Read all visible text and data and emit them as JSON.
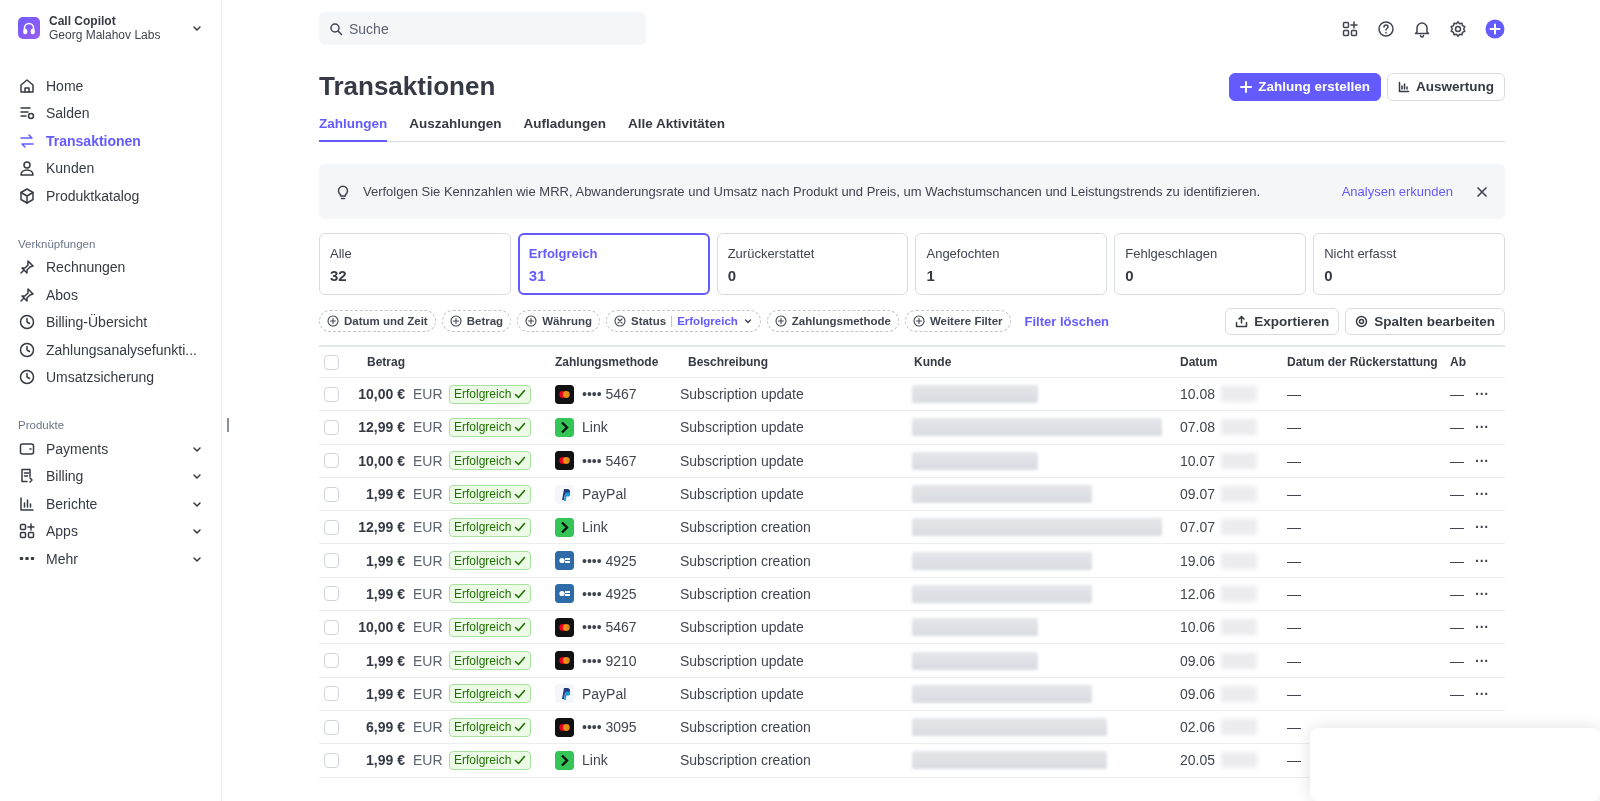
{
  "account": {
    "name": "Call Copilot",
    "org": "Georg Malahov Labs"
  },
  "sidebar": {
    "items": [
      {
        "label": "Home",
        "selected": false
      },
      {
        "label": "Salden",
        "selected": false
      },
      {
        "label": "Transaktionen",
        "selected": true
      },
      {
        "label": "Kunden",
        "selected": false
      },
      {
        "label": "Produktkatalog",
        "selected": false
      }
    ],
    "sections": [
      {
        "title": "Verknüpfungen",
        "items": [
          {
            "label": "Rechnungen"
          },
          {
            "label": "Abos"
          },
          {
            "label": "Billing-Übersicht"
          },
          {
            "label": "Zahlungsanalysefunkti..."
          },
          {
            "label": "Umsatzsicherung"
          }
        ]
      },
      {
        "title": "Produkte",
        "items": [
          {
            "label": "Payments",
            "expanded": false
          },
          {
            "label": "Billing",
            "expanded": false
          },
          {
            "label": "Berichte",
            "expanded": false
          },
          {
            "label": "Apps",
            "expanded": false
          },
          {
            "label": "Mehr",
            "expanded": false
          }
        ]
      }
    ]
  },
  "search": {
    "placeholder": "Suche"
  },
  "page_title": "Transaktionen",
  "actions": [
    {
      "label": "Zahlung erstellen",
      "kind": "primary"
    },
    {
      "label": "Auswertung",
      "kind": "secondary"
    }
  ],
  "tabs": [
    {
      "label": "Zahlungen",
      "selected": true
    },
    {
      "label": "Auszahlungen",
      "selected": false
    },
    {
      "label": "Aufladungen",
      "selected": false
    },
    {
      "label": "Alle Aktivitäten",
      "selected": false
    }
  ],
  "banner": {
    "text": "Verfolgen Sie Kennzahlen wie MRR, Abwanderungsrate und Umsatz nach Produkt und Preis, um Wachstumschancen und Leistungstrends zu identifizieren.",
    "link": "Analysen erkunden"
  },
  "status_cards": [
    {
      "label": "Alle",
      "count": "32",
      "selected": false
    },
    {
      "label": "Erfolgreich",
      "count": "31",
      "selected": true
    },
    {
      "label": "Zurückerstattet",
      "count": "0",
      "selected": false
    },
    {
      "label": "Angefochten",
      "count": "1",
      "selected": false
    },
    {
      "label": "Fehlgeschlagen",
      "count": "0",
      "selected": false
    },
    {
      "label": "Nicht erfasst",
      "count": "0",
      "selected": false
    }
  ],
  "filters": [
    {
      "kind": "add",
      "label": "Datum und Zeit"
    },
    {
      "kind": "add",
      "label": "Betrag"
    },
    {
      "kind": "add",
      "label": "Währung"
    },
    {
      "kind": "active",
      "label": "Status",
      "value": "Erfolgreich"
    },
    {
      "kind": "add",
      "label": "Zahlungsmethode"
    },
    {
      "kind": "add",
      "label": "Weitere Filter"
    }
  ],
  "clear_filters": "Filter löschen",
  "toolbar": [
    {
      "label": "Exportieren",
      "kind": "export"
    },
    {
      "label": "Spalten bearbeiten",
      "kind": "settings"
    }
  ],
  "table": {
    "select_all_checked": false,
    "columns": [
      "Betrag",
      "Zahlungsmethode",
      "Beschreibung",
      "Kunde",
      "Datum",
      "Datum der Rückerstattung",
      "Ab"
    ],
    "rows": [
      {
        "amount": "10,00 €",
        "currency": "EUR",
        "status": "Erfolgreich",
        "kind": "mastercard",
        "method": "•••• 5467",
        "description": "Subscription update",
        "date": "10.08",
        "refund": "—",
        "column_7": "—",
        "menu": "···",
        "checked": false
      },
      {
        "amount": "12,99 €",
        "currency": "EUR",
        "status": "Erfolgreich",
        "kind": "link",
        "method": "Link",
        "description": "Subscription update",
        "date": "07.08",
        "refund": "—",
        "column_7": "—",
        "menu": "···",
        "checked": false
      },
      {
        "amount": "10,00 €",
        "currency": "EUR",
        "status": "Erfolgreich",
        "kind": "mastercard",
        "method": "•••• 5467",
        "description": "Subscription update",
        "date": "10.07",
        "refund": "—",
        "column_7": "—",
        "menu": "···",
        "checked": false
      },
      {
        "amount": "1,99 €",
        "currency": "EUR",
        "status": "Erfolgreich",
        "kind": "paypal",
        "method": "PayPal",
        "description": "Subscription update",
        "date": "09.07",
        "refund": "—",
        "column_7": "—",
        "menu": "···",
        "checked": false
      },
      {
        "amount": "12,99 €",
        "currency": "EUR",
        "status": "Erfolgreich",
        "kind": "link",
        "method": "Link",
        "description": "Subscription creation",
        "date": "07.07",
        "refund": "—",
        "column_7": "—",
        "menu": "···",
        "checked": false
      },
      {
        "amount": "1,99 €",
        "currency": "EUR",
        "status": "Erfolgreich",
        "kind": "card",
        "method": "•••• 4925",
        "description": "Subscription creation",
        "date": "19.06",
        "refund": "—",
        "column_7": "—",
        "menu": "···",
        "checked": false
      },
      {
        "amount": "1,99 €",
        "currency": "EUR",
        "status": "Erfolgreich",
        "kind": "card",
        "method": "•••• 4925",
        "description": "Subscription creation",
        "date": "12.06",
        "refund": "—",
        "column_7": "—",
        "menu": "···",
        "checked": false
      },
      {
        "amount": "10,00 €",
        "currency": "EUR",
        "status": "Erfolgreich",
        "kind": "mastercard",
        "method": "•••• 5467",
        "description": "Subscription update",
        "date": "10.06",
        "refund": "—",
        "column_7": "—",
        "menu": "···",
        "checked": false
      },
      {
        "amount": "1,99 €",
        "currency": "EUR",
        "status": "Erfolgreich",
        "kind": "mastercard",
        "method": "•••• 9210",
        "description": "Subscription update",
        "date": "09.06",
        "refund": "—",
        "column_7": "—",
        "menu": "···",
        "checked": false
      },
      {
        "amount": "1,99 €",
        "currency": "EUR",
        "status": "Erfolgreich",
        "kind": "paypal",
        "method": "PayPal",
        "description": "Subscription update",
        "date": "09.06",
        "refund": "—",
        "column_7": "—",
        "menu": "···",
        "checked": false
      },
      {
        "amount": "6,99 €",
        "currency": "EUR",
        "status": "Erfolgreich",
        "kind": "mastercard",
        "method": "•••• 3095",
        "description": "Subscription creation",
        "date": "02.06",
        "refund": "—",
        "checked": false
      },
      {
        "amount": "1,99 €",
        "currency": "EUR",
        "status": "Erfolgreich",
        "kind": "link",
        "method": "Link",
        "description": "Subscription creation",
        "date": "20.05",
        "refund": "—",
        "checked": false
      }
    ]
  }
}
